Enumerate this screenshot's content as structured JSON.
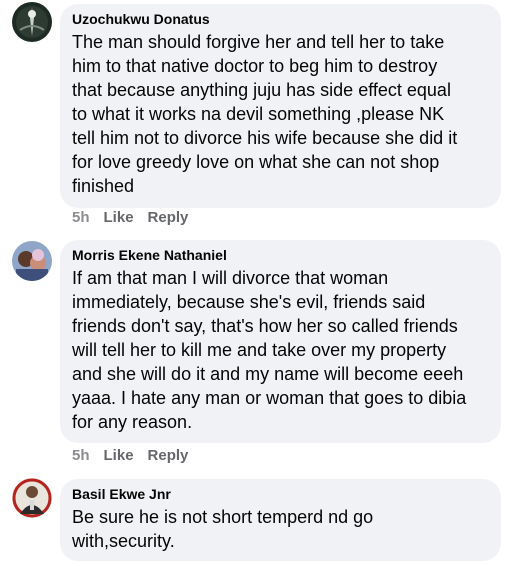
{
  "comments": [
    {
      "author": "Uzochukwu Donatus",
      "text": "The man should forgive her and tell her to take\nhim to that native doctor to beg him to destroy\nthat because anything juju has side effect equal\nto what it works na devil something ,please NK\ntell him not to divorce his wife because she did it\nfor love greedy love on what she can not shop\nfinished",
      "time": "5h",
      "like_label": "Like",
      "reply_label": "Reply"
    },
    {
      "author": "Morris Ekene Nathaniel",
      "text": "If am that man I will divorce that woman\nimmediately,  because she's evil,  friends said\nfriends don't say,  that's how her so called friends\nwill tell her to kill me and take over my property\nand she will do it and my name will become eeeh\nyaaa. I hate any man or woman that goes to dibia\nfor any reason.",
      "time": "5h",
      "like_label": "Like",
      "reply_label": "Reply"
    },
    {
      "author": "Basil Ekwe Jnr",
      "text": "Be sure he is not short temperd nd go\nwith,security."
    }
  ]
}
